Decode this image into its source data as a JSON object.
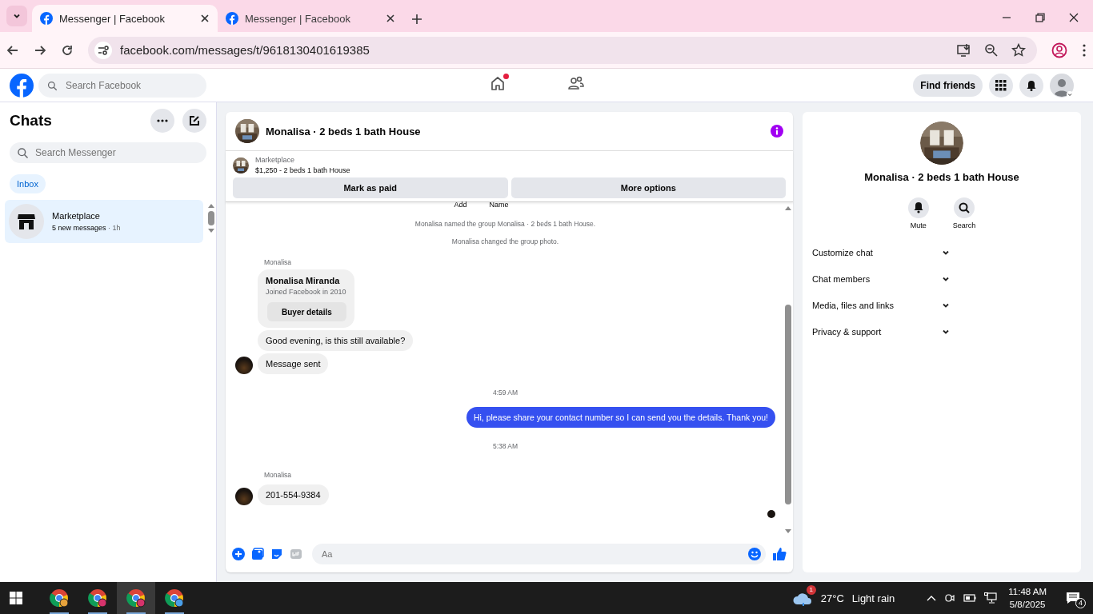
{
  "browser": {
    "tabs": [
      {
        "title": "Messenger | Facebook",
        "selected": true
      },
      {
        "title": "Messenger | Facebook",
        "selected": false
      }
    ],
    "url": "facebook.com/messages/t/9618130401619385"
  },
  "header": {
    "search": {
      "placeholder": "Search Facebook"
    },
    "home_notification": true,
    "find_friends": "Find friends"
  },
  "sidebar": {
    "title": "Chats",
    "search": {
      "placeholder": "Search Messenger"
    },
    "filters": [
      {
        "label": "Inbox",
        "selected": true
      }
    ],
    "chats": [
      {
        "name": "Marketplace",
        "preview": "5 new messages",
        "time": "· 1h",
        "selected": true
      }
    ]
  },
  "chat": {
    "title": "Monalisa · 2 beds 1 bath House",
    "listing": {
      "source": "Marketplace",
      "text": "$1,250 - 2 beds 1 bath House"
    },
    "actions": [
      "Mark as paid",
      "More options"
    ],
    "partial_labels": [
      "Add",
      "Name"
    ],
    "messages": [
      {
        "kind": "system",
        "text": "Monalisa named the group Monalisa · 2 beds 1 bath House."
      },
      {
        "kind": "system",
        "text": "Monalisa changed the group photo."
      },
      {
        "kind": "sender",
        "text": "Monalisa"
      },
      {
        "kind": "profile",
        "name": "Monalisa Miranda",
        "subtitle": "Joined Facebook in 2010",
        "button": "Buyer details"
      },
      {
        "kind": "incoming",
        "text": "Good evening, is this still available?",
        "avatar": false
      },
      {
        "kind": "incoming",
        "text": "Message sent",
        "avatar": true
      },
      {
        "kind": "time",
        "text": "4:59 AM"
      },
      {
        "kind": "outgoing",
        "text": "Hi, please share your contact number so I can send you the details. Thank you!"
      },
      {
        "kind": "time",
        "text": "5:38 AM"
      },
      {
        "kind": "sender",
        "text": "Monalisa"
      },
      {
        "kind": "incoming",
        "text": "201-554-9384",
        "avatar": true
      }
    ],
    "composer": {
      "placeholder": "Aa"
    }
  },
  "details": {
    "title": "Monalisa · 2 beds 1 bath House",
    "actions": [
      {
        "kind": "bell",
        "label": "Mute"
      },
      {
        "kind": "search",
        "label": "Search"
      }
    ],
    "sections": [
      {
        "label": "Customize chat",
        "expanded": false
      },
      {
        "label": "Chat members",
        "expanded": false
      },
      {
        "label": "Media, files and links",
        "expanded": false
      },
      {
        "label": "Privacy & support",
        "expanded": false
      }
    ]
  },
  "taskbar": {
    "weather_badge": "1",
    "temperature": "27°C",
    "weather": "Light rain",
    "time": "11:48 AM",
    "date": "5/8/2025",
    "notifications": "4"
  }
}
